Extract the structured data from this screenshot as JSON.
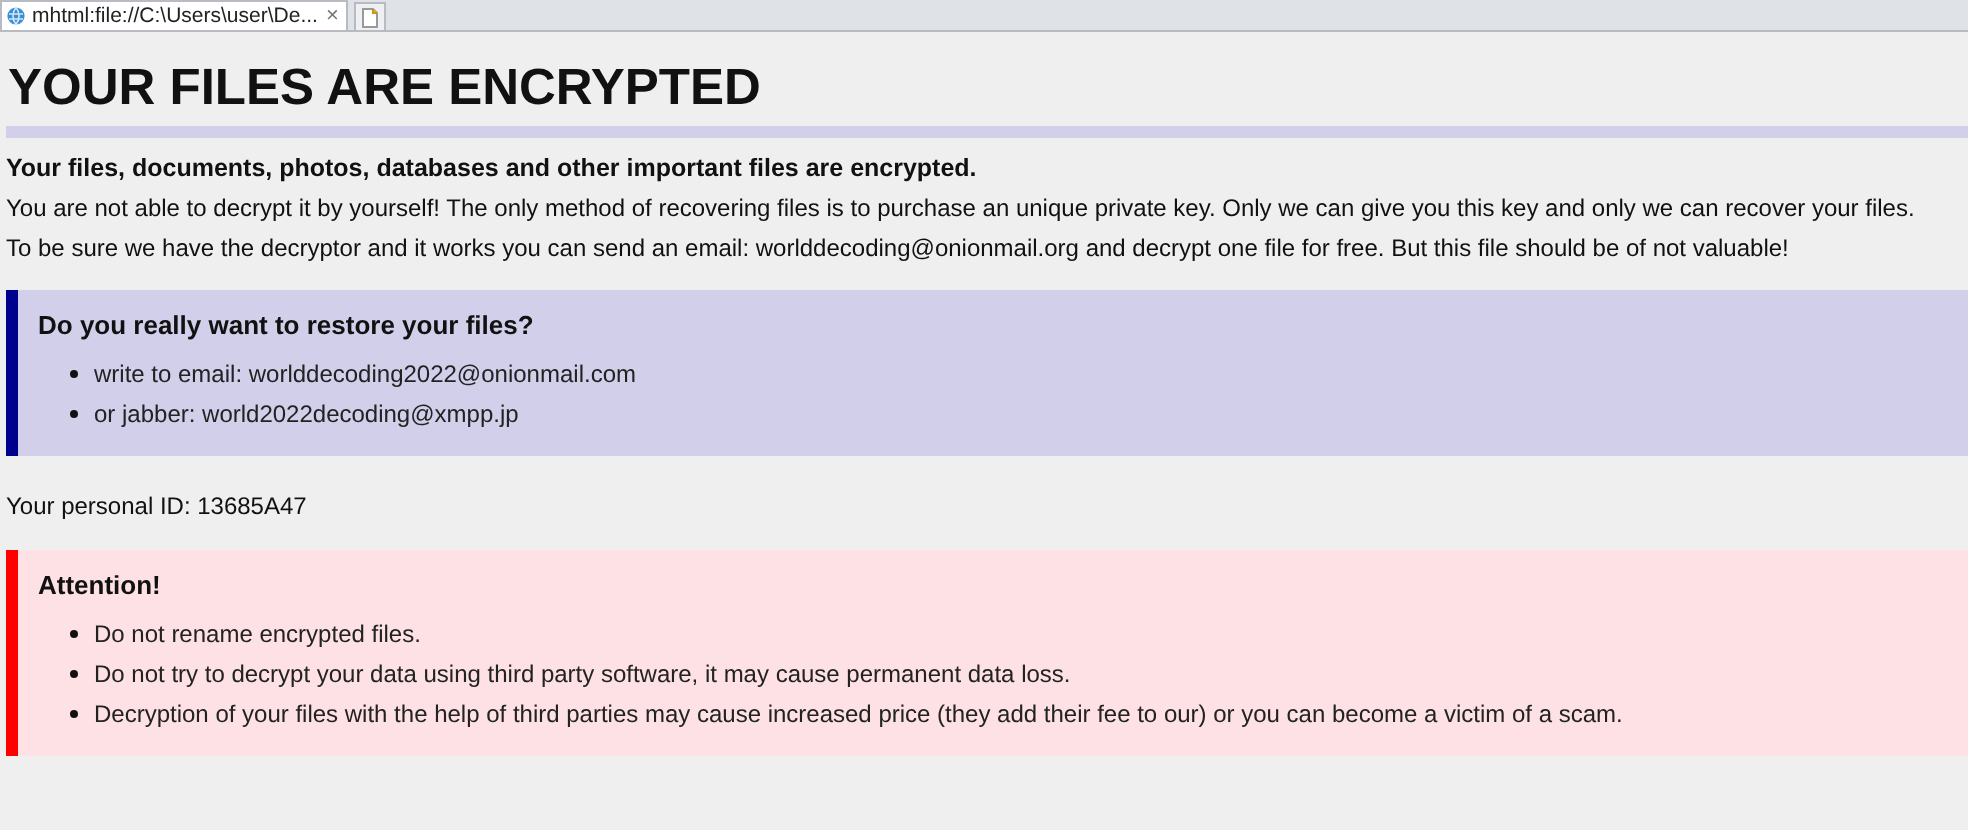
{
  "tab": {
    "title": "mhtml:file://C:\\Users\\user\\De...",
    "close": "×",
    "selected": true
  },
  "heading": "YOUR FILES ARE ENCRYPTED",
  "intro": [
    {
      "kind": "bold",
      "text": "Your files, documents, photos, databases and other important files are encrypted."
    },
    {
      "kind": "plain",
      "text": "You are not able to decrypt it by yourself! The only method of recovering files is to purchase an unique private key. Only we can give you this key and only we can recover your files."
    },
    {
      "kind": "plain",
      "text": "To be sure we have the decryptor and it works you can send an email: worlddecoding@onionmail.org and decrypt one file for free. But this file should be of not valuable!"
    }
  ],
  "contact_box": {
    "kind": "info",
    "title": "Do you really want to restore your files?",
    "items": [
      "write to email: worlddecoding2022@onionmail.com",
      "or jabber: world2022decoding@xmpp.jp"
    ]
  },
  "personal_id": "Your personal ID: 13685A47",
  "attention_box": {
    "kind": "warning",
    "title": "Attention!",
    "items": [
      "Do not rename encrypted files.",
      "Do not try to decrypt your data using third party software, it may cause permanent data loss.",
      "Decryption of your files with the help of third parties may cause increased price (they add their fee to our) or you can become a victim of a scam."
    ]
  }
}
